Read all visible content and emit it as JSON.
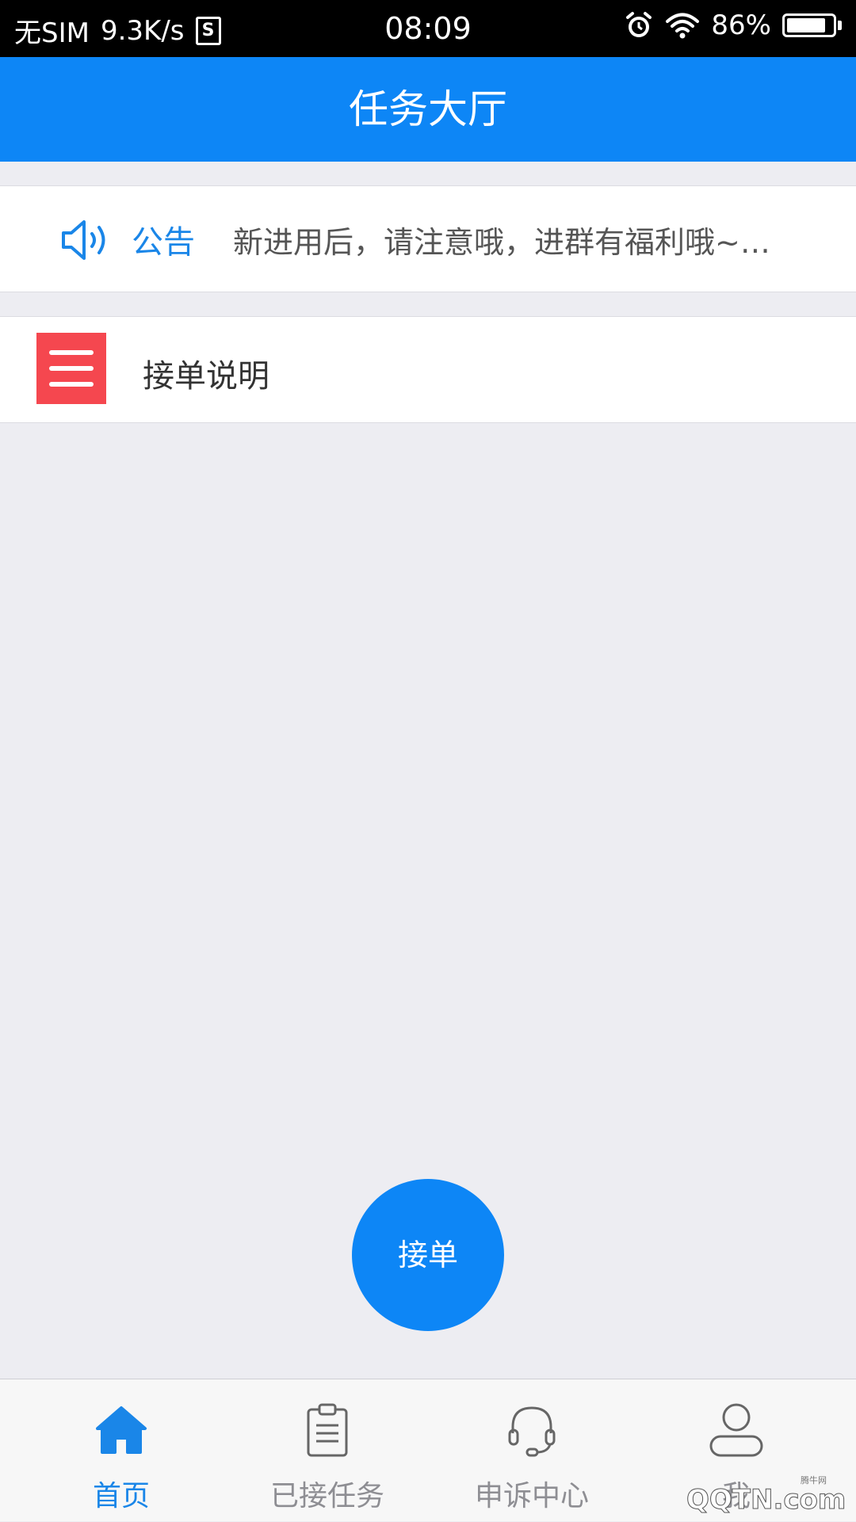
{
  "status_bar": {
    "carrier": "无SIM",
    "speed": "9.3K/s",
    "sim_badge": "S",
    "time": "08:09",
    "battery_percent": "86%",
    "battery_level": 0.86,
    "icons": [
      "alarm-icon",
      "wifi-icon",
      "battery-icon"
    ]
  },
  "nav": {
    "title": "任务大厅"
  },
  "notice": {
    "label": "公告",
    "text": "新进用后，请注意哦，进群有福利哦~…",
    "icon": "speaker-icon"
  },
  "instructions": {
    "label": "接单说明",
    "icon": "menu-icon"
  },
  "accept_button": {
    "label": "接单"
  },
  "tabs": [
    {
      "label": "首页",
      "icon": "home-icon",
      "active": true
    },
    {
      "label": "已接任务",
      "icon": "clipboard-icon",
      "active": false
    },
    {
      "label": "申诉中心",
      "icon": "headset-icon",
      "active": false
    },
    {
      "label": "我",
      "icon": "user-icon",
      "active": false
    }
  ],
  "watermark": {
    "text": "QQTN.com",
    "sub": "腾牛网"
  },
  "colors": {
    "primary": "#0d86f6",
    "notice_label": "#1a86e8",
    "menu_icon_bg": "#f5474f",
    "background": "#ededf2",
    "tab_inactive": "#8e8e93"
  }
}
